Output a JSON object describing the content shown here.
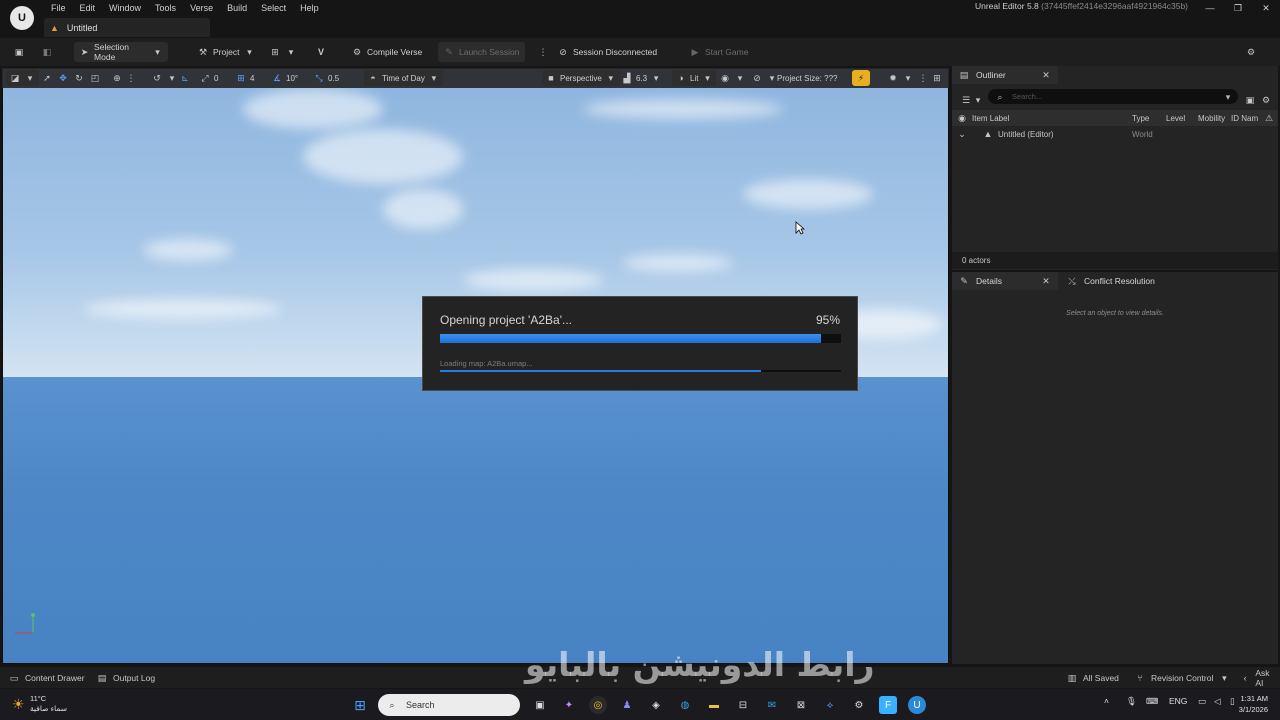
{
  "window": {
    "title": "Unreal Editor 5.8",
    "build_hash": "(37445ffef2414e3296aaf4921964c35b)",
    "tab_label": "Untitled"
  },
  "menu": [
    "File",
    "Edit",
    "Window",
    "Tools",
    "Verse",
    "Build",
    "Select",
    "Help"
  ],
  "toolbar": {
    "selection_mode": "Selection Mode",
    "project": "Project",
    "compile_verse": "Compile Verse",
    "launch_session": "Launch Session",
    "session_status": "Session Disconnected",
    "start_game": "Start Game"
  },
  "viewport_toolbar": {
    "rotate_snap_value": "0",
    "grid_value": "4",
    "angle_snap": "10°",
    "scale_snap": "0.5",
    "time_of_day": "Time of Day",
    "perspective": "Perspective",
    "fov_value": "6.3",
    "lit": "Lit",
    "project_size": "Project Size: ???"
  },
  "progress_dialog": {
    "title": "Opening project 'A2Ba'...",
    "percent_label": "95%",
    "progress": 0.95,
    "subtask": "Loading map: A2Ba.umap...",
    "subtask_progress": 0.8
  },
  "outliner": {
    "tab_label": "Outliner",
    "search_placeholder": "Search...",
    "columns": [
      "Item Label",
      "Type",
      "Level",
      "Mobility",
      "ID Nam"
    ],
    "rows": [
      {
        "label": "Untitled (Editor)",
        "type": "World"
      }
    ],
    "footer": "0 actors"
  },
  "details": {
    "tab_label": "Details",
    "conflict_tab": "Conflict Resolution",
    "empty_message": "Select an object to view details."
  },
  "statusbar": {
    "content_drawer": "Content Drawer",
    "output_log": "Output Log",
    "all_saved": "All Saved",
    "revision_control": "Revision Control",
    "ask_ai": "Ask AI"
  },
  "watermark": "رابط الدونيشن بالبايو",
  "taskbar": {
    "temperature": "11°C",
    "weather_desc": "سماء صافية",
    "search_placeholder": "Search",
    "language": "ENG",
    "time": "1:31 AM",
    "date": "3/1/2026"
  },
  "colors": {
    "accent_blue": "#1f6fd6",
    "panel_bg": "#242424",
    "toolbar_bg": "#1e1e1e",
    "sky": "#a7c7e7",
    "sea": "#4d87c6"
  }
}
